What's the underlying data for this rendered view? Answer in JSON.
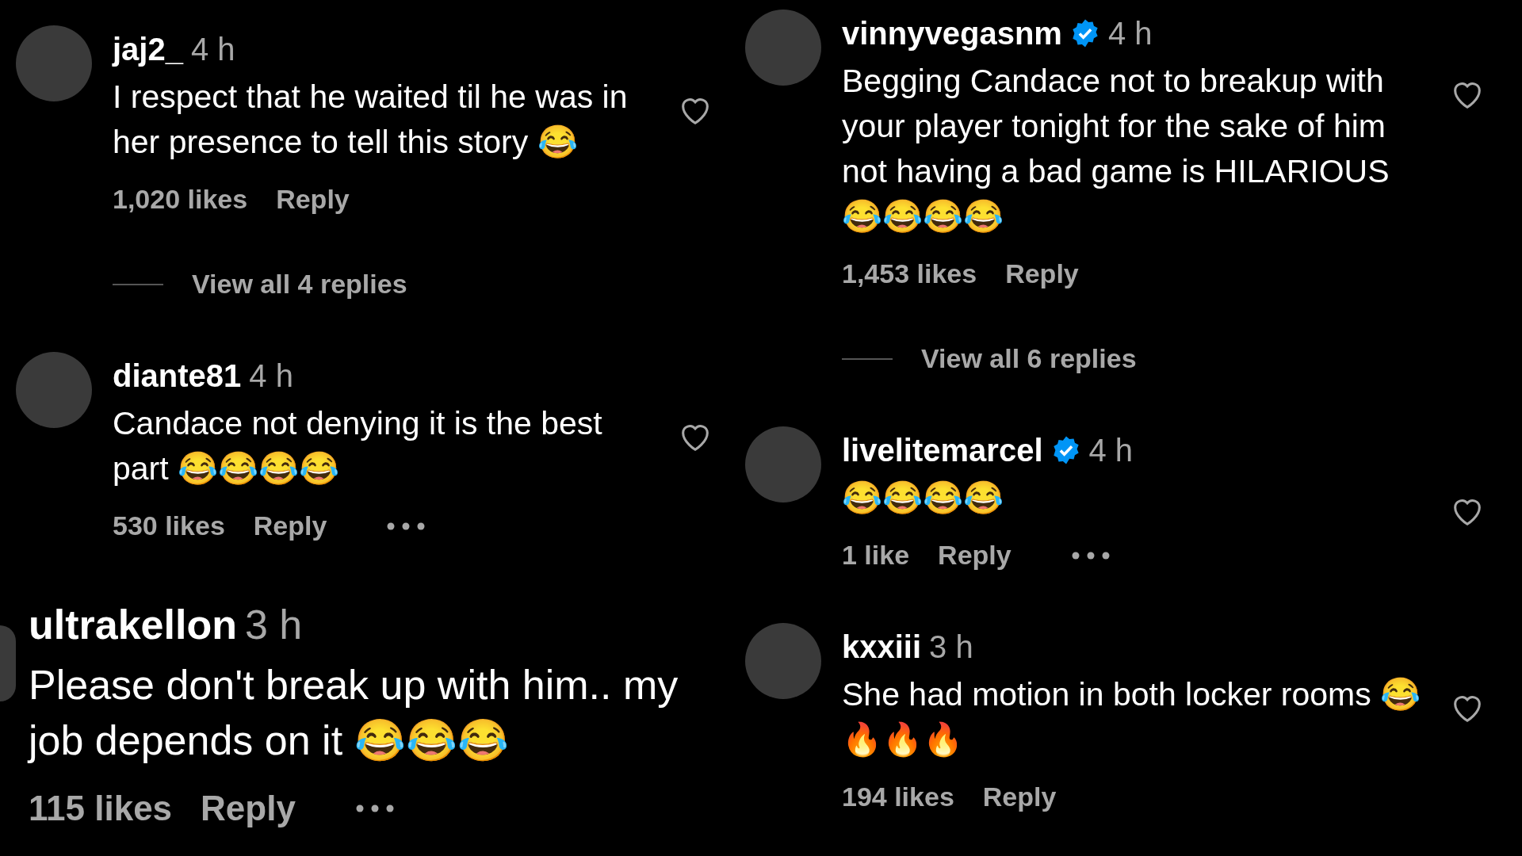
{
  "columns": [
    {
      "comments": [
        {
          "kind": "standard",
          "username": "jaj2_",
          "verified": false,
          "time": "4 h",
          "text": "I respect that he waited til he was in her presence to tell this story 😂",
          "likes": "1,020 likes",
          "reply": "Reply",
          "more": false,
          "view_replies": "View all 4 replies"
        },
        {
          "kind": "standard",
          "username": "diante81",
          "verified": false,
          "time": "4 h",
          "text": "Candace not denying it is the best part 😂😂😂😂",
          "likes": "530 likes",
          "reply": "Reply",
          "more": true
        },
        {
          "kind": "enlarged",
          "username": "ultrakellon",
          "verified": false,
          "time": "3 h",
          "text": "Please don't break up with him.. my job depends on it 😂😂😂",
          "likes": "115 likes",
          "reply": "Reply",
          "more": true
        }
      ]
    },
    {
      "comments": [
        {
          "kind": "standard",
          "username": "vinnyvegasnm",
          "verified": true,
          "time": "4 h",
          "text": "Begging Candace not to breakup with your player tonight for the sake of him not having a bad game is HILARIOUS 😂😂😂😂",
          "likes": "1,453 likes",
          "reply": "Reply",
          "more": false,
          "view_replies": "View all 6 replies"
        },
        {
          "kind": "standard",
          "username": "livelitemarcel",
          "verified": true,
          "time": "4 h",
          "text": "😂😂😂😂",
          "likes": "1 like",
          "reply": "Reply",
          "more": true
        },
        {
          "kind": "standard",
          "username": "kxxiii",
          "verified": false,
          "time": "3 h",
          "text": "She had motion in both locker rooms 😂🔥🔥🔥",
          "likes": "194 likes",
          "reply": "Reply",
          "more": false
        }
      ]
    }
  ]
}
